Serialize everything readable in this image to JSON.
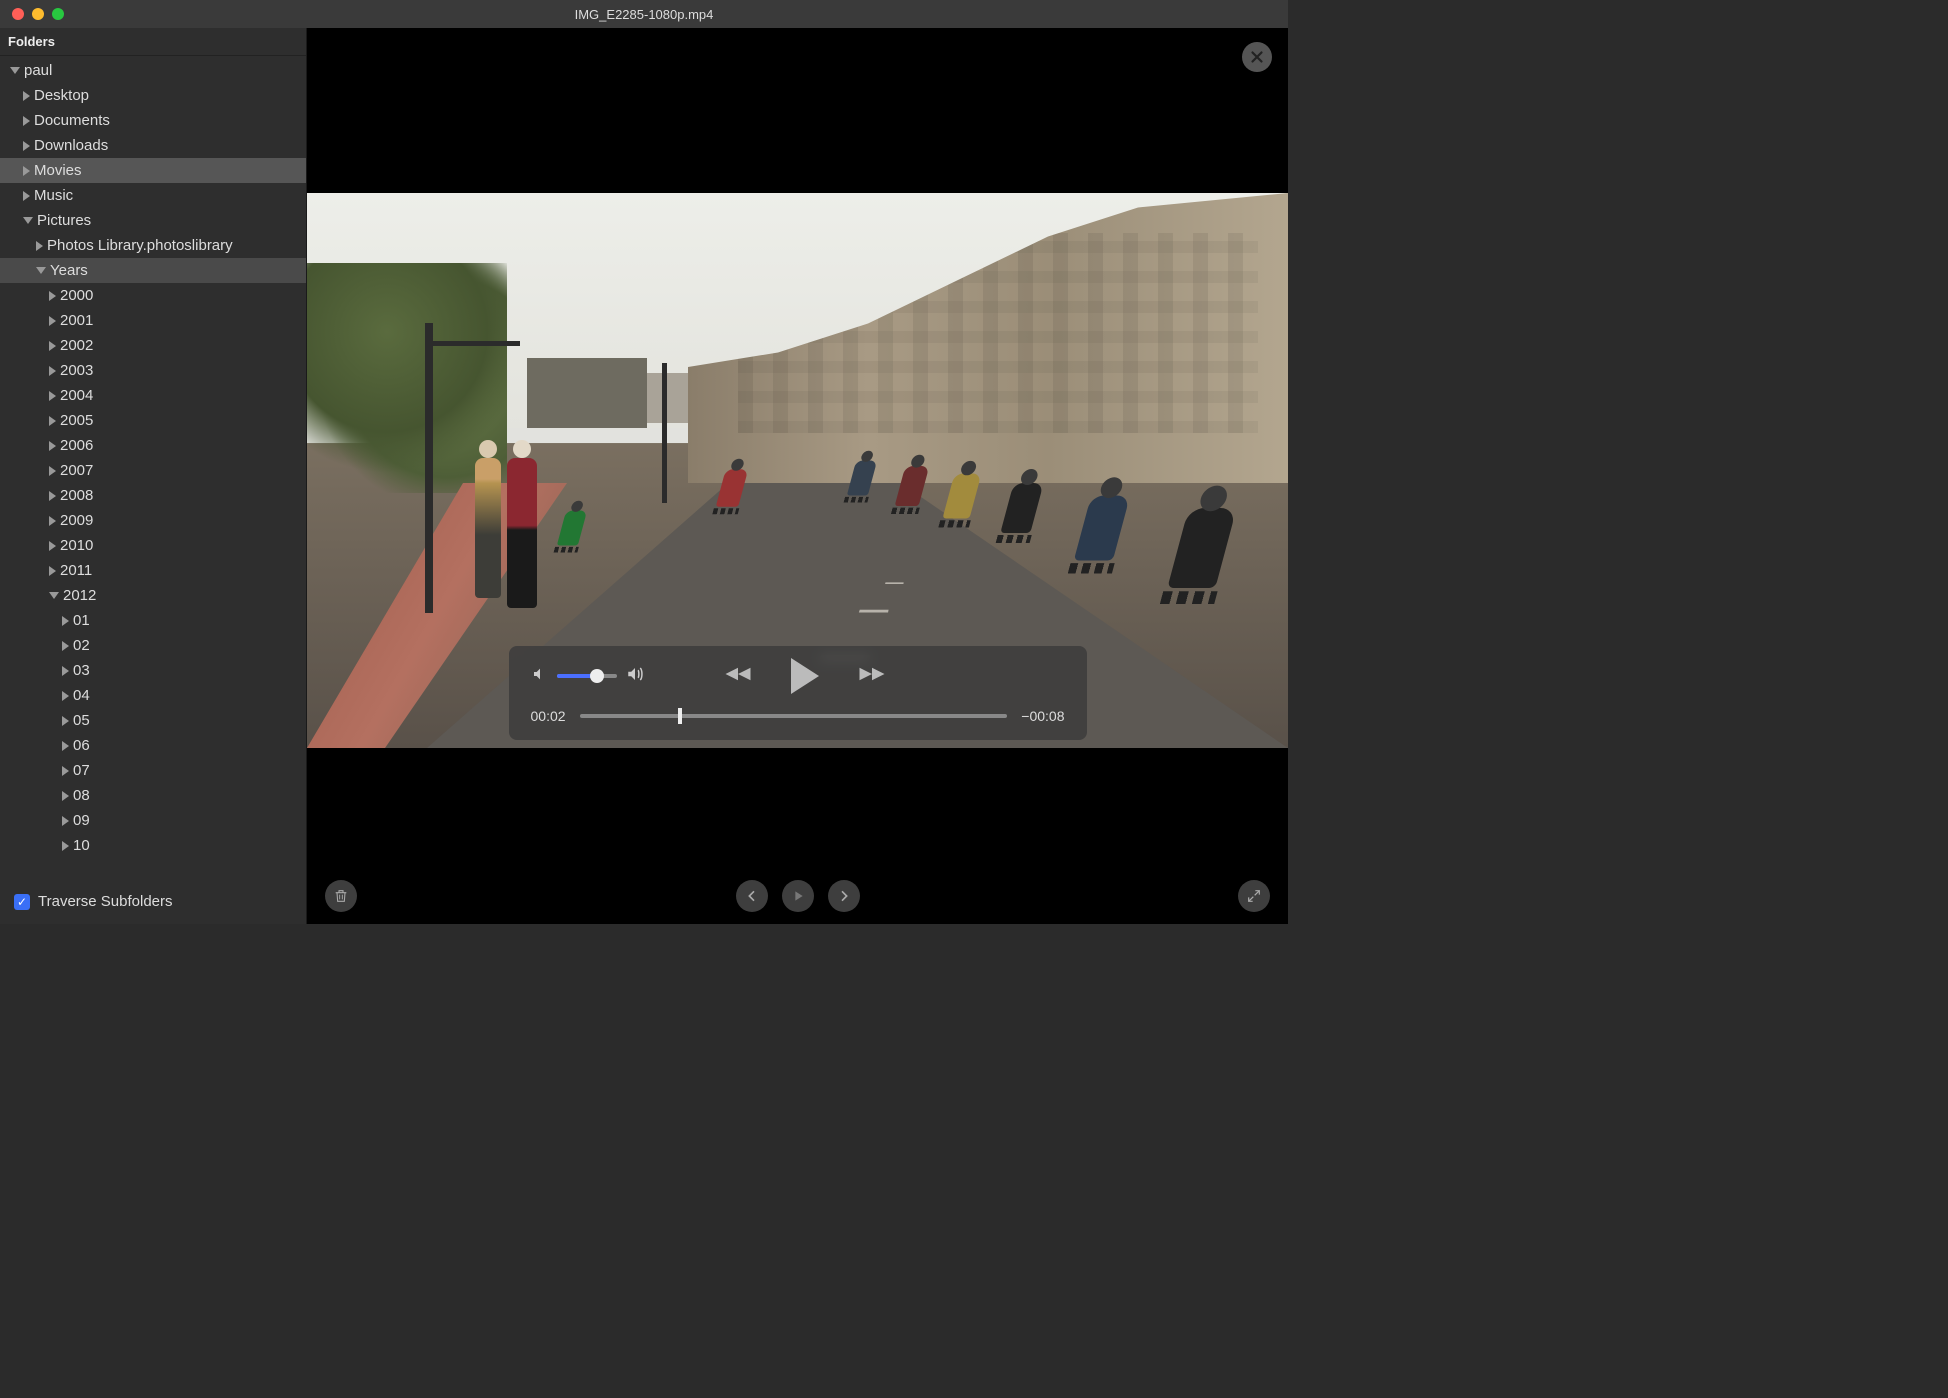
{
  "window": {
    "title": "IMG_E2285-1080p.mp4"
  },
  "sidebar": {
    "header": "Folders",
    "tree": [
      {
        "label": "paul",
        "indent": 0,
        "state": "open"
      },
      {
        "label": "Desktop",
        "indent": 1,
        "state": "closed"
      },
      {
        "label": "Documents",
        "indent": 1,
        "state": "closed"
      },
      {
        "label": "Downloads",
        "indent": 1,
        "state": "closed"
      },
      {
        "label": "Movies",
        "indent": 1,
        "state": "closed",
        "selected": true
      },
      {
        "label": "Music",
        "indent": 1,
        "state": "closed"
      },
      {
        "label": "Pictures",
        "indent": 1,
        "state": "open"
      },
      {
        "label": "Photos Library.photoslibrary",
        "indent": 2,
        "state": "closed"
      },
      {
        "label": "Years",
        "indent": 2,
        "state": "open",
        "subselected": true
      },
      {
        "label": "2000",
        "indent": 3,
        "state": "closed"
      },
      {
        "label": "2001",
        "indent": 3,
        "state": "closed"
      },
      {
        "label": "2002",
        "indent": 3,
        "state": "closed"
      },
      {
        "label": "2003",
        "indent": 3,
        "state": "closed"
      },
      {
        "label": "2004",
        "indent": 3,
        "state": "closed"
      },
      {
        "label": "2005",
        "indent": 3,
        "state": "closed"
      },
      {
        "label": "2006",
        "indent": 3,
        "state": "closed"
      },
      {
        "label": "2007",
        "indent": 3,
        "state": "closed"
      },
      {
        "label": "2008",
        "indent": 3,
        "state": "closed"
      },
      {
        "label": "2009",
        "indent": 3,
        "state": "closed"
      },
      {
        "label": "2010",
        "indent": 3,
        "state": "closed"
      },
      {
        "label": "2011",
        "indent": 3,
        "state": "closed"
      },
      {
        "label": "2012",
        "indent": 3,
        "state": "open"
      },
      {
        "label": "01",
        "indent": 4,
        "state": "closed"
      },
      {
        "label": "02",
        "indent": 4,
        "state": "closed"
      },
      {
        "label": "03",
        "indent": 4,
        "state": "closed"
      },
      {
        "label": "04",
        "indent": 4,
        "state": "closed"
      },
      {
        "label": "05",
        "indent": 4,
        "state": "closed"
      },
      {
        "label": "06",
        "indent": 4,
        "state": "closed"
      },
      {
        "label": "07",
        "indent": 4,
        "state": "closed"
      },
      {
        "label": "08",
        "indent": 4,
        "state": "closed"
      },
      {
        "label": "09",
        "indent": 4,
        "state": "closed"
      },
      {
        "label": "10",
        "indent": 4,
        "state": "closed"
      }
    ],
    "footer": {
      "checkbox_checked": true,
      "label": "Traverse Subfolders"
    }
  },
  "player": {
    "elapsed": "00:02",
    "remaining": "−00:08",
    "volume_percent": 60,
    "progress_percent": 23
  }
}
